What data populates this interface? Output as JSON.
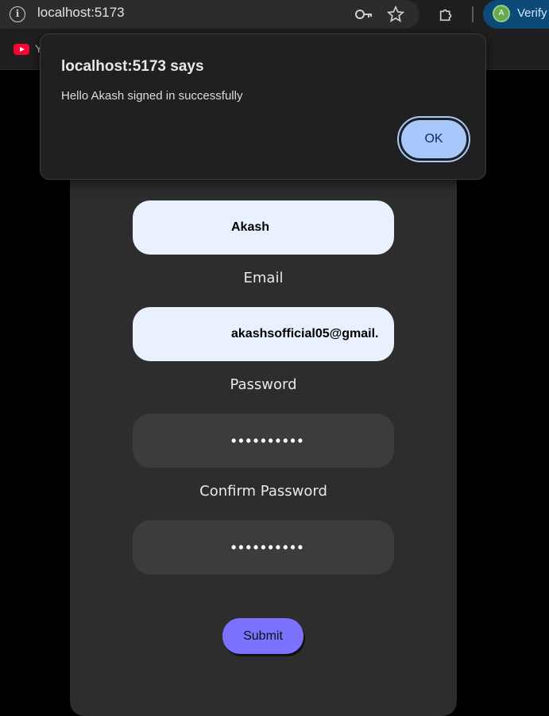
{
  "browser": {
    "url": "localhost:5173",
    "profile_label": "Verify",
    "avatar_letter": "A",
    "bookmark_label": "Y"
  },
  "form": {
    "name_value": "Akash",
    "email_label": "Email",
    "email_value": "akashsofficial05@gmail.",
    "password_label": "Password",
    "password_value": "••••••••••",
    "confirm_label": "Confirm Password",
    "confirm_value": "••••••••••",
    "submit_label": "Submit"
  },
  "dialog": {
    "title": "localhost:5173 says",
    "message": "Hello Akash signed in successfully",
    "ok_label": "OK"
  }
}
